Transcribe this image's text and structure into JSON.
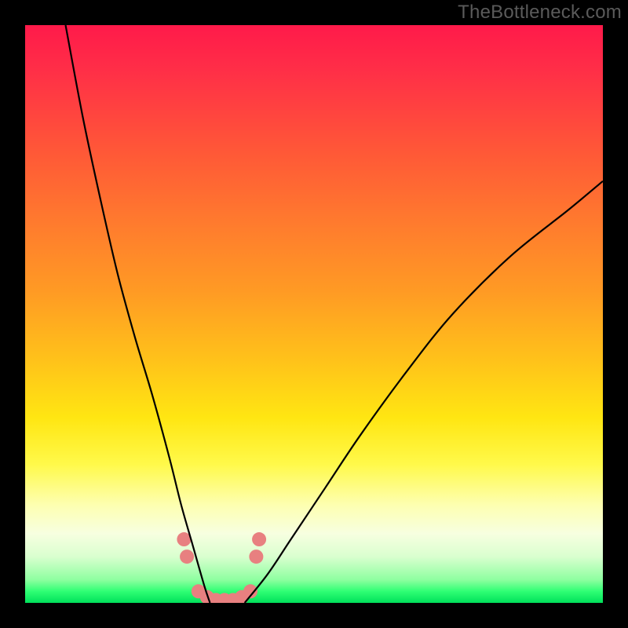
{
  "watermark": "TheBottleneck.com",
  "chart_data": {
    "type": "line",
    "title": "",
    "xlabel": "",
    "ylabel": "",
    "xlim": [
      0,
      100
    ],
    "ylim": [
      0,
      100
    ],
    "gradient_stops": [
      {
        "pct": 0,
        "color": "#ff1a4a"
      },
      {
        "pct": 8,
        "color": "#ff2f47"
      },
      {
        "pct": 22,
        "color": "#ff5837"
      },
      {
        "pct": 34,
        "color": "#ff7a2e"
      },
      {
        "pct": 46,
        "color": "#ff9a24"
      },
      {
        "pct": 58,
        "color": "#ffc21a"
      },
      {
        "pct": 68,
        "color": "#ffe612"
      },
      {
        "pct": 76,
        "color": "#fff94a"
      },
      {
        "pct": 83,
        "color": "#fdffb0"
      },
      {
        "pct": 88,
        "color": "#f7ffe0"
      },
      {
        "pct": 92,
        "color": "#d9ffcf"
      },
      {
        "pct": 96,
        "color": "#8effa0"
      },
      {
        "pct": 98,
        "color": "#2fff74"
      },
      {
        "pct": 100,
        "color": "#00e05a"
      }
    ],
    "series": [
      {
        "name": "left-curve",
        "x": [
          7,
          10,
          13,
          16,
          19,
          22,
          25,
          27,
          29,
          31,
          32
        ],
        "y": [
          100,
          84,
          70,
          57,
          46,
          36,
          25,
          17,
          10,
          3,
          0
        ]
      },
      {
        "name": "right-curve",
        "x": [
          38,
          42,
          46,
          52,
          58,
          66,
          74,
          84,
          94,
          100
        ],
        "y": [
          0,
          5,
          11,
          20,
          29,
          40,
          50,
          60,
          68,
          73
        ]
      }
    ],
    "highlight_dots": {
      "color": "#e88080",
      "radius_px": 9,
      "points": [
        {
          "x": 27.5,
          "y": 11
        },
        {
          "x": 28.0,
          "y": 8
        },
        {
          "x": 30.0,
          "y": 2
        },
        {
          "x": 31.5,
          "y": 1
        },
        {
          "x": 33.0,
          "y": 0.5
        },
        {
          "x": 34.5,
          "y": 0.5
        },
        {
          "x": 36.0,
          "y": 0.5
        },
        {
          "x": 37.5,
          "y": 1
        },
        {
          "x": 39.0,
          "y": 2
        },
        {
          "x": 40.0,
          "y": 8
        },
        {
          "x": 40.5,
          "y": 11
        }
      ]
    }
  }
}
